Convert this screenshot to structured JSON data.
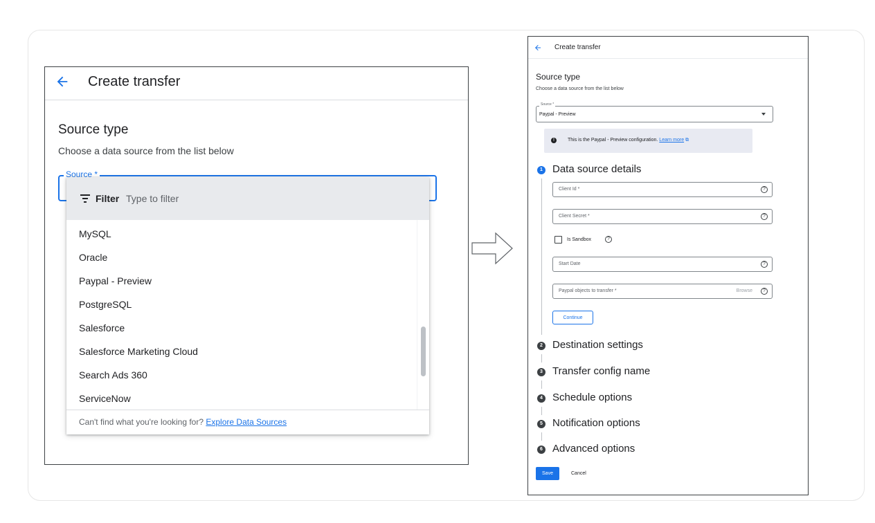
{
  "left": {
    "header": {
      "title": "Create transfer"
    },
    "source_type": {
      "title": "Source type",
      "subtitle": "Choose a data source from the list below"
    },
    "source_field": {
      "label": "Source *"
    },
    "dropdown": {
      "filter_label": "Filter",
      "filter_placeholder": "Type to filter",
      "items": [
        "MySQL",
        "Oracle",
        "Paypal - Preview",
        "PostgreSQL",
        "Salesforce",
        "Salesforce Marketing Cloud",
        "Search Ads 360",
        "ServiceNow"
      ],
      "footer_text": "Can't find what you're looking for?",
      "footer_link": "Explore Data Sources"
    }
  },
  "right": {
    "header": {
      "title": "Create transfer"
    },
    "source_type": {
      "title": "Source type",
      "subtitle": "Choose a data source from the list below",
      "field_label": "Source *",
      "field_value": "Paypal - Preview"
    },
    "info": {
      "text": "This is the Paypal - Preview configuration.",
      "link": "Learn more"
    },
    "steps": [
      {
        "num": "1",
        "title": "Data source details"
      },
      {
        "num": "2",
        "title": "Destination settings"
      },
      {
        "num": "3",
        "title": "Transfer config name"
      },
      {
        "num": "4",
        "title": "Schedule options"
      },
      {
        "num": "5",
        "title": "Notification options"
      },
      {
        "num": "6",
        "title": "Advanced options"
      }
    ],
    "fields": {
      "client_id": "Client Id *",
      "client_secret": "Client Secret *",
      "is_sandbox": "Is Sandbox",
      "start_date": "Start Date",
      "paypal_objects": "Paypal objects to transfer *",
      "browse": "Browse"
    },
    "continue_label": "Continue",
    "save_label": "Save",
    "cancel_label": "Cancel"
  },
  "colors": {
    "accent": "#1a73e8",
    "filter_bg": "#e8eaed",
    "info_bg": "#e8eaf2"
  }
}
